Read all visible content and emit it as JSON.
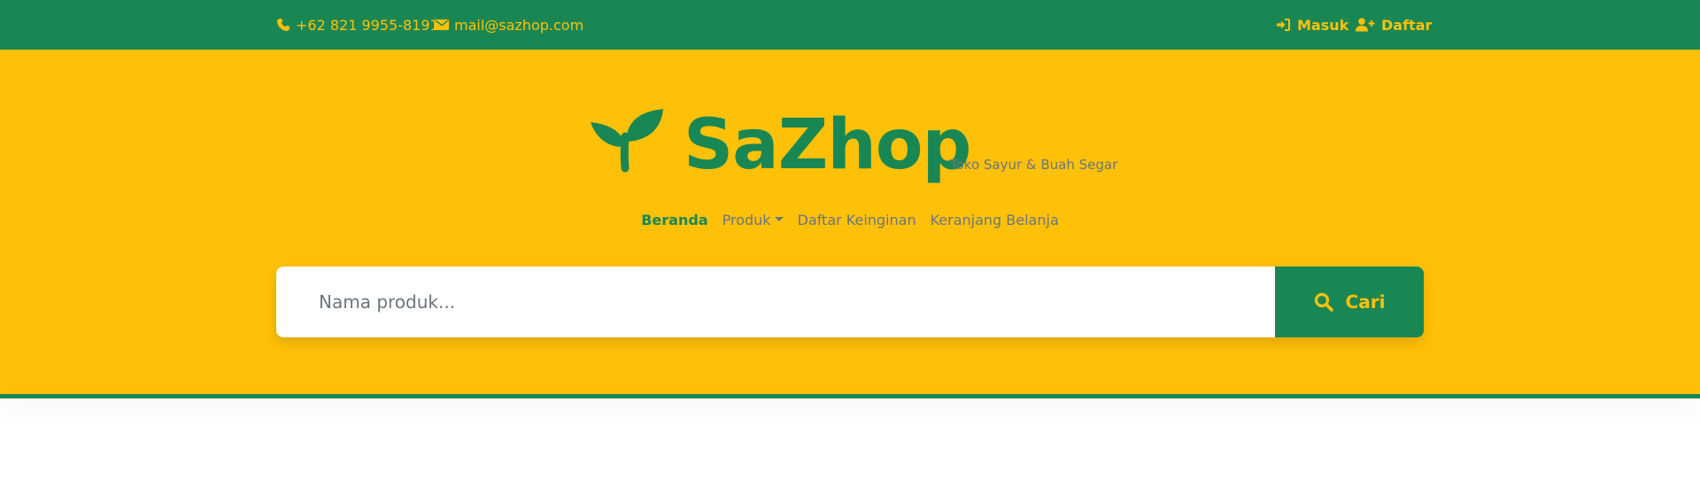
{
  "colors": {
    "primary": "#198754",
    "accent": "#ffc107",
    "muted": "#6c757d"
  },
  "topbar": {
    "phone": "+62 821 9955-8191",
    "phone_icon": "phone-icon",
    "email": "mail@sazhop.com",
    "email_icon": "envelope-icon",
    "login_label": "Masuk",
    "login_icon": "sign-in-icon",
    "register_label": "Daftar",
    "register_icon": "user-plus-icon"
  },
  "brand": {
    "name": "SaZhop",
    "tagline": "Toko Sayur & Buah Segar",
    "logo_icon": "sprout-icon"
  },
  "nav": {
    "items": [
      {
        "label": "Beranda",
        "active": true
      },
      {
        "label": "Produk",
        "dropdown": true
      },
      {
        "label": "Daftar Keinginan"
      },
      {
        "label": "Keranjang Belanja"
      }
    ]
  },
  "search": {
    "placeholder": "Nama produk...",
    "value": "",
    "button_label": "Cari",
    "button_icon": "search-icon"
  }
}
